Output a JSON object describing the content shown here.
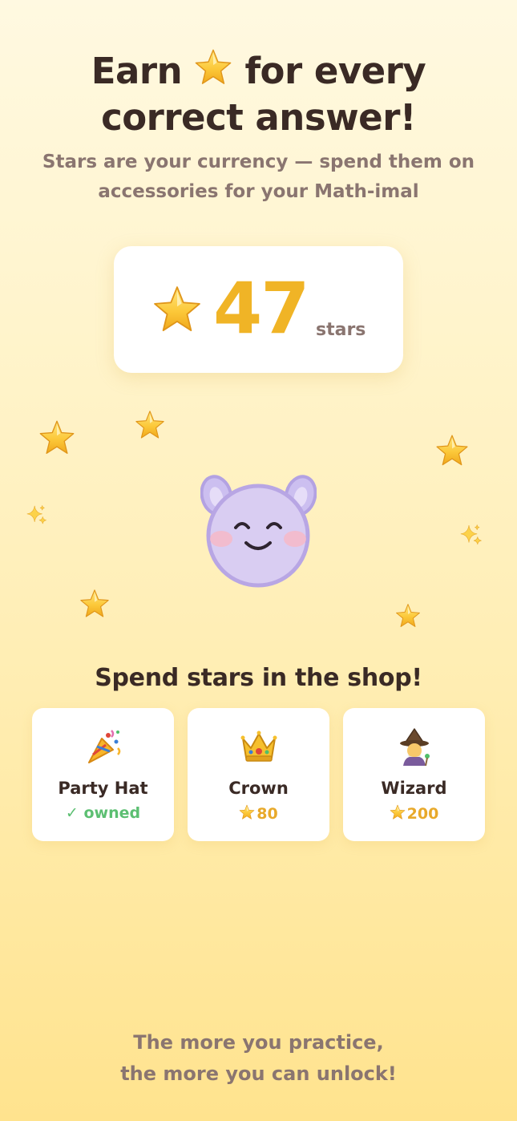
{
  "headline": {
    "part1": "Earn ",
    "part2": " for every",
    "line2": "correct answer!"
  },
  "subhead": "Stars are your currency — spend them on accessories for your Math-imal",
  "balance": {
    "icon": "star-icon",
    "value": "47",
    "unit": "stars"
  },
  "mascot": {
    "icon": "mathimal-face-icon",
    "color": "#d9cdf2"
  },
  "shop": {
    "title": "Spend stars in the shop!",
    "items": [
      {
        "icon": "party-popper-icon",
        "name": "Party Hat",
        "status": "✓ owned"
      },
      {
        "icon": "crown-icon",
        "name": "Crown",
        "price": "80"
      },
      {
        "icon": "wizard-icon",
        "name": "Wizard",
        "price": "200"
      }
    ]
  },
  "footer": {
    "line1": "The more you practice,",
    "line2": "the more you can unlock!"
  },
  "colors": {
    "accent": "#f0b426",
    "owned": "#5cbf72",
    "text": "#3a2a25",
    "muted": "#8a7570"
  }
}
